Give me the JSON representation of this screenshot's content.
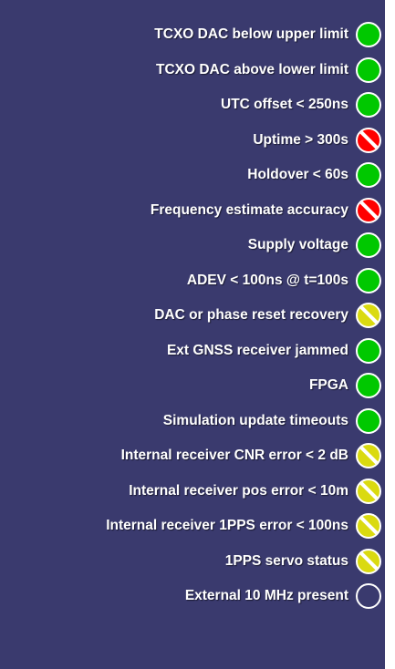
{
  "status_list": {
    "items": [
      {
        "label": "TCXO DAC below upper limit",
        "state": "ok"
      },
      {
        "label": "TCXO DAC above lower limit",
        "state": "ok"
      },
      {
        "label": "UTC offset < 250ns",
        "state": "ok"
      },
      {
        "label": "Uptime > 300s",
        "state": "error"
      },
      {
        "label": "Holdover < 60s",
        "state": "ok"
      },
      {
        "label": "Frequency estimate accuracy",
        "state": "error"
      },
      {
        "label": "Supply voltage",
        "state": "ok"
      },
      {
        "label": "ADEV < 100ns @ t=100s",
        "state": "ok"
      },
      {
        "label": "DAC or phase reset recovery",
        "state": "warning"
      },
      {
        "label": "Ext GNSS receiver jammed",
        "state": "ok"
      },
      {
        "label": "FPGA",
        "state": "ok"
      },
      {
        "label": "Simulation update timeouts",
        "state": "ok"
      },
      {
        "label": "Internal receiver CNR error < 2 dB",
        "state": "warning"
      },
      {
        "label": "Internal receiver pos error < 10m",
        "state": "warning"
      },
      {
        "label": "Internal receiver 1PPS error < 100ns",
        "state": "warning"
      },
      {
        "label": "1PPS servo status",
        "state": "warning"
      },
      {
        "label": "External 10 MHz present",
        "state": "off"
      }
    ]
  },
  "colors": {
    "background": "#3a3a6e",
    "ok": "#00c800",
    "error": "#ff0000",
    "warning": "#dada10",
    "text": "#ffffff"
  }
}
